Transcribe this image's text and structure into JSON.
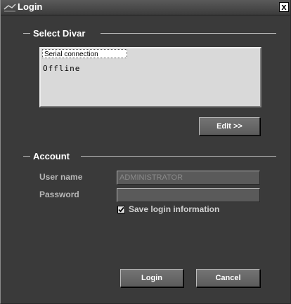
{
  "window": {
    "title": "Login",
    "close_glyph": "x"
  },
  "select_divar": {
    "group_title": "Select Divar",
    "list_selected": "Serial connection",
    "list_item": "Offline",
    "edit_button": "Edit >>"
  },
  "account": {
    "group_title": "Account",
    "username_label": "User name",
    "username_value": "ADMINISTRATOR",
    "password_label": "Password",
    "password_value": "",
    "save_login_label": "Save login information",
    "save_login_checked": true
  },
  "actions": {
    "login": "Login",
    "cancel": "Cancel"
  },
  "icons": {
    "title_icon": "app-icon",
    "close": "close-icon",
    "check": "checkmark-icon"
  }
}
